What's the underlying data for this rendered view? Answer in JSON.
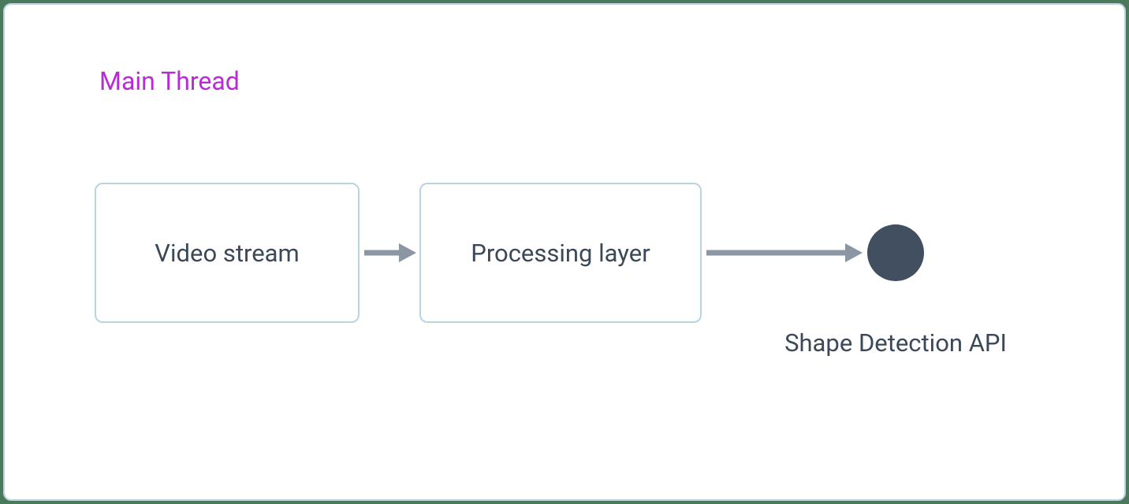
{
  "title": "Main Thread",
  "nodes": {
    "box1": "Video stream",
    "box2": "Processing layer",
    "endpoint": "Shape Detection API"
  },
  "colors": {
    "title": "#b82bd6",
    "box_border": "#b8d4e3",
    "text": "#3a4858",
    "arrow": "#8a96a3",
    "circle": "#424f60",
    "page_outer": "#4a7a5a"
  }
}
